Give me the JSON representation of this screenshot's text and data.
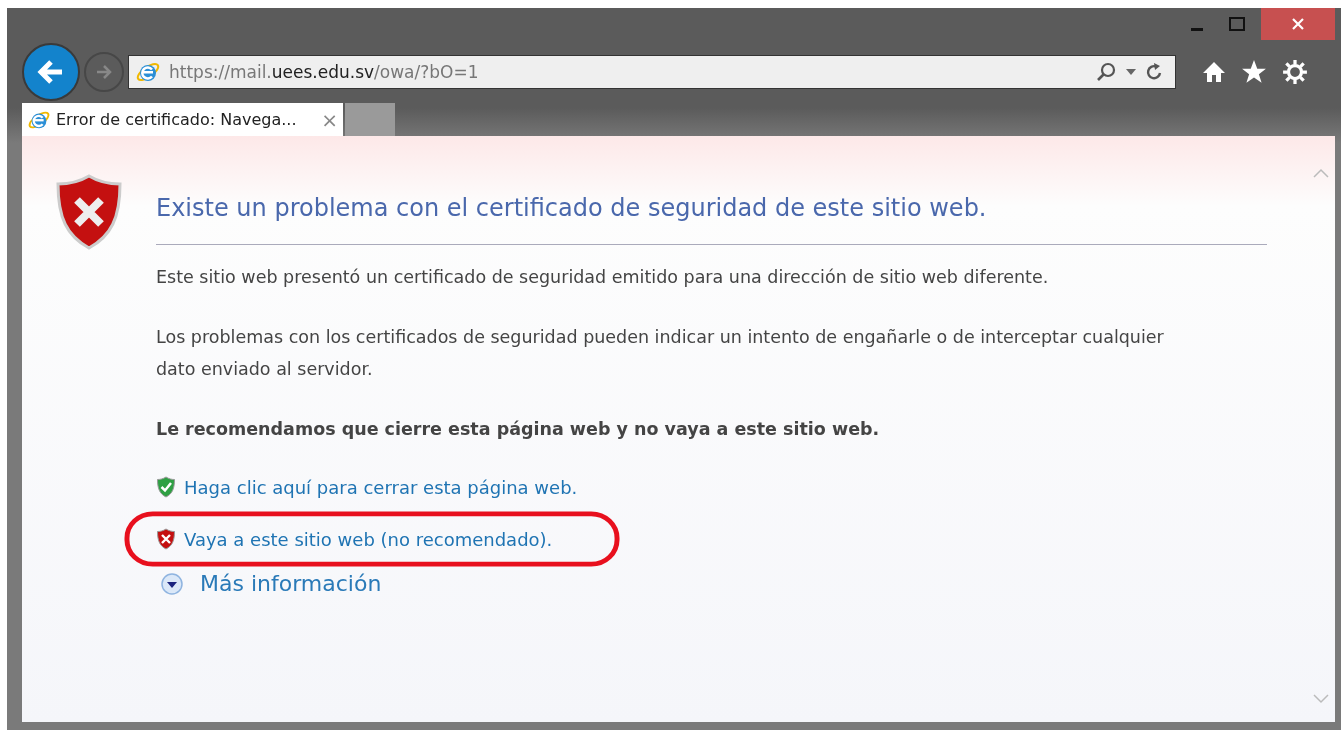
{
  "window": {
    "controls": [
      {
        "kind": "minimize"
      },
      {
        "kind": "maximize"
      },
      {
        "kind": "close"
      }
    ]
  },
  "address_bar": {
    "url": "https://mail.**uees.edu.sv**/owa/?bO=1"
  },
  "tabs": [
    {
      "label": "Error de certificado: Navega...",
      "selected": true,
      "close": "×"
    },
    {
      "selected": false
    }
  ],
  "page": {
    "heading": "Existe un problema con el certificado de seguridad de este sitio web.",
    "paragraphs": [
      "Este sitio web presentó un certificado de seguridad emitido para una dirección de sitio web diferente.",
      "Los problemas con los certificados de seguridad pueden indicar un intento de engañarle o de interceptar cualquier dato enviado al servidor."
    ],
    "recommendation": "Le recomendamos que cierre esta página web y no vaya a este sitio web.",
    "links": [
      {
        "kind": "safe",
        "text": "Haga clic aquí para cerrar esta página web.",
        "highlighted": false
      },
      {
        "kind": "unsafe",
        "text": "Vaya a este sitio web (no recomendado).",
        "highlighted": true
      }
    ],
    "more_info": {
      "text": "Más información",
      "expanded": false
    }
  }
}
